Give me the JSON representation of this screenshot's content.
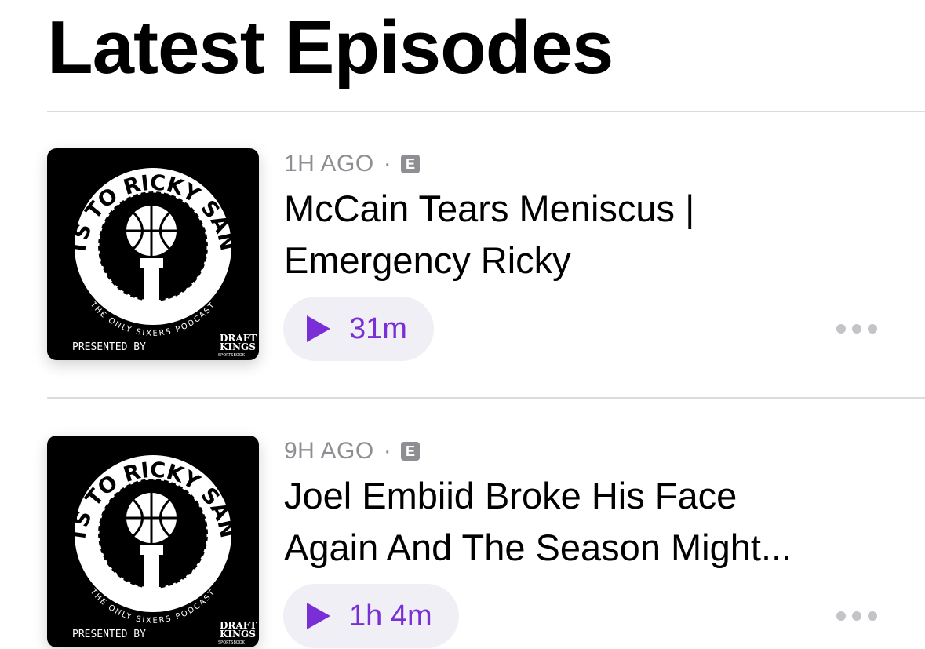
{
  "header": {
    "title": "Latest Episodes"
  },
  "artwork": {
    "show_name_top": "RIGHTS TO RICKY SANCHEZ",
    "tagline": "THE ONLY SIXERS PODCAST",
    "presented_by": "PRESENTED BY",
    "sponsor_line1": "DRAFT",
    "sponsor_line2": "KINGS",
    "sponsor_line3": "SPORTSBOOK"
  },
  "episodes": [
    {
      "age": "1H AGO",
      "separator": "·",
      "explicit": "E",
      "title_line1": "McCain Tears Meniscus |",
      "title_line2": "Emergency Ricky",
      "duration": "31m"
    },
    {
      "age": "9H AGO",
      "separator": "·",
      "explicit": "E",
      "title_line1": "Joel Embiid Broke His Face",
      "title_line2": "Again And The Season Might...",
      "duration": "1h 4m"
    }
  ],
  "colors": {
    "accent": "#7a2fd6",
    "secondary_text": "#8e8e93",
    "pill_bg": "#f0eff5"
  },
  "icons": {
    "play": "play-icon",
    "more": "ellipsis-icon",
    "explicit": "explicit-badge"
  }
}
